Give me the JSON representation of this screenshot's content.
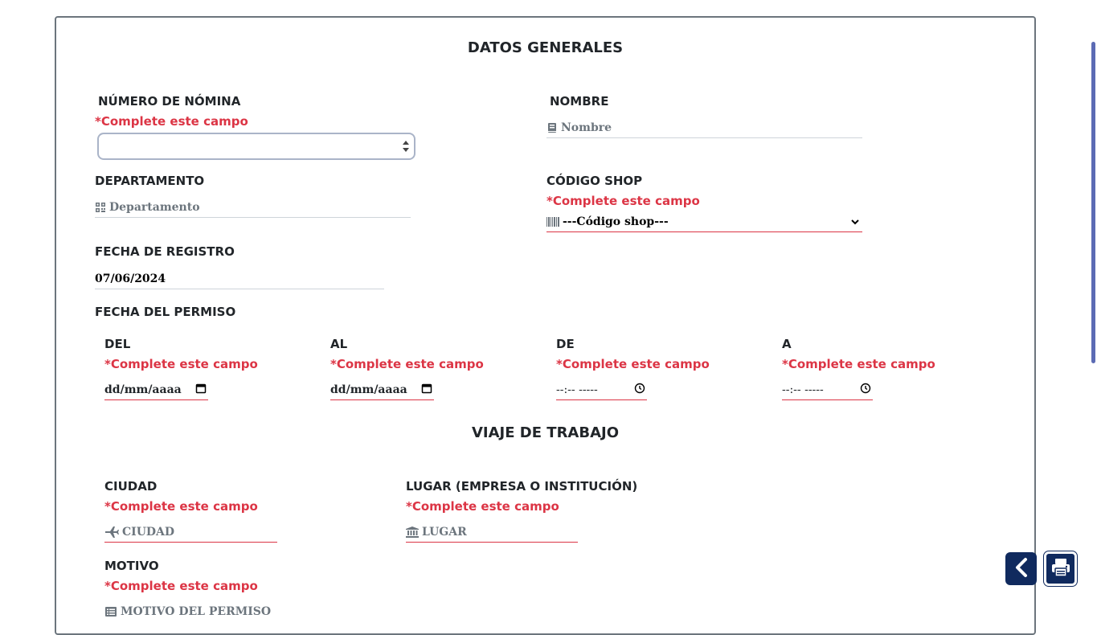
{
  "sections": {
    "general_title": "DATOS GENERALES",
    "trip_title": "VIAJE DE TRABAJO"
  },
  "required_msg": "*Complete este campo",
  "fields": {
    "nomina": {
      "label": "NÚMERO DE NÓMINA",
      "value": ""
    },
    "nombre": {
      "label": "NOMBRE",
      "placeholder": "Nombre",
      "icon": "book-icon"
    },
    "departamento": {
      "label": "DEPARTAMENTO",
      "placeholder": "Departamento",
      "icon": "qrcode-icon"
    },
    "codigo_shop": {
      "label": "CÓDIGO SHOP",
      "selected": "---Código shop---",
      "icon": "barcode-icon"
    },
    "fecha_registro": {
      "label": "FECHA DE REGISTRO",
      "value": "07/06/2024"
    },
    "fecha_permiso": {
      "label": "FECHA DEL PERMISO"
    },
    "del": {
      "label": "DEL",
      "placeholder": "dd/mm/aaaa",
      "icon": "calendar-icon"
    },
    "al": {
      "label": "AL",
      "placeholder": "dd/mm/aaaa",
      "icon": "calendar-icon"
    },
    "de": {
      "label": "DE",
      "placeholder": "--:-- -----",
      "icon": "clock-icon"
    },
    "a": {
      "label": "A",
      "placeholder": "--:-- -----",
      "icon": "clock-icon"
    },
    "ciudad": {
      "label": "CIUDAD",
      "placeholder": "CIUDAD",
      "icon": "plane-icon"
    },
    "lugar": {
      "label": "LUGAR (EMPRESA O INSTITUCIÓN)",
      "placeholder": "LUGAR",
      "icon": "bank-icon"
    },
    "motivo": {
      "label": "MOTIVO",
      "placeholder": "MOTIVO DEL PERMISO",
      "icon": "list-icon"
    }
  },
  "colors": {
    "required": "#dc3545",
    "fab_bg": "#102a5e",
    "scroll_accent": "#5c6bb4"
  },
  "floating": {
    "back_icon": "chevron-left-icon",
    "print_icon": "print-icon"
  }
}
